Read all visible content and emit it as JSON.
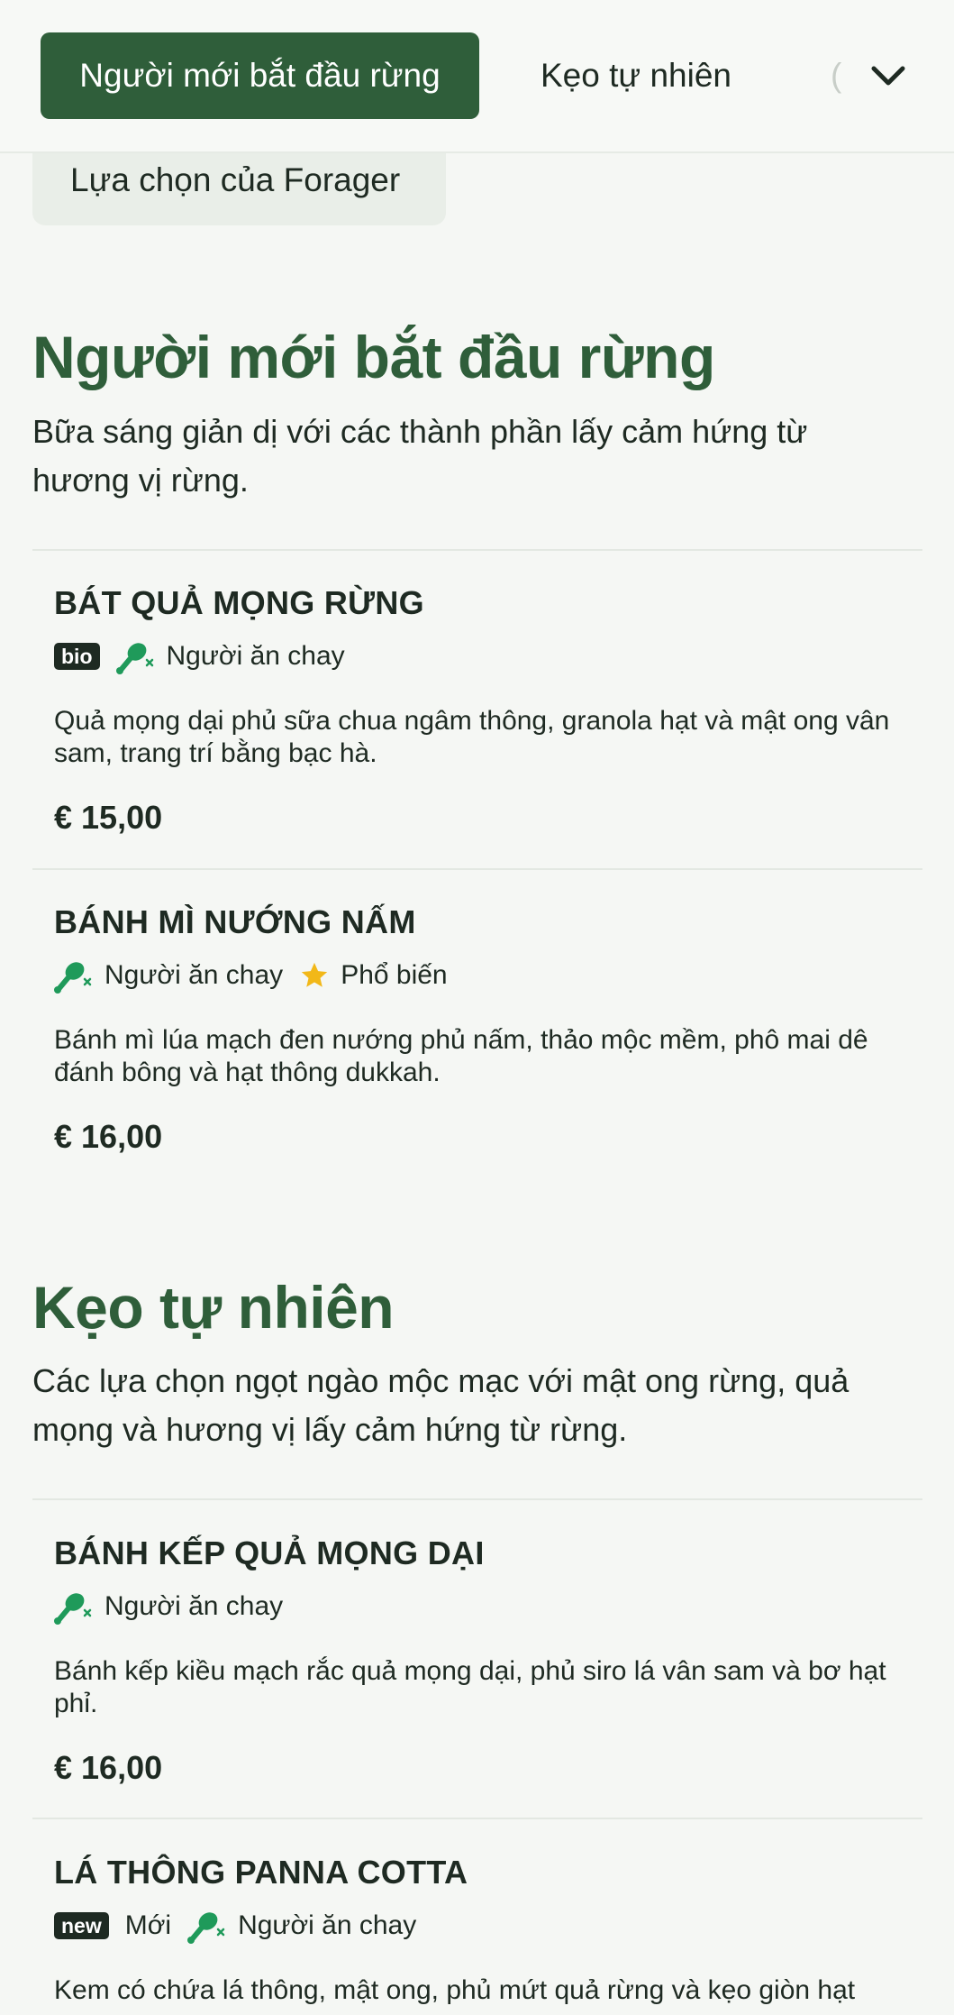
{
  "nav": {
    "active_tab": "Người mới bắt đầu rừng",
    "tab_2": "Kẹo tự nhiên",
    "partial_tab": "Lựa chọn của Forager"
  },
  "sections": [
    {
      "title": "Người mới bắt đầu rừng",
      "description": "Bữa sáng giản dị với các thành phần lấy cảm hứng từ hương vị rừng.",
      "items": [
        {
          "name": "BÁT QUẢ MỌNG RỪNG",
          "badge": "bio",
          "tags": [
            "Người ăn chay"
          ],
          "description": "Quả mọng dại phủ sữa chua ngâm thông, granola hạt và mật ong vân sam, trang trí bằng bạc hà.",
          "price": "€ 15,00"
        },
        {
          "name": "BÁNH MÌ NƯỚNG NẤM",
          "tags": [
            "Người ăn chay",
            "Phổ biến"
          ],
          "description": "Bánh mì lúa mạch đen nướng phủ nấm, thảo mộc mềm, phô mai dê đánh bông và hạt thông dukkah.",
          "price": "€ 16,00"
        }
      ]
    },
    {
      "title": "Kẹo tự nhiên",
      "description": "Các lựa chọn ngọt ngào mộc mạc với mật ong rừng, quả mọng và hương vị lấy cảm hứng từ rừng.",
      "items": [
        {
          "name": "BÁNH KẾP QUẢ MỌNG DẠI",
          "tags": [
            "Người ăn chay"
          ],
          "description": "Bánh kếp kiều mạch rắc quả mọng dại, phủ siro lá vân sam và bơ hạt phỉ.",
          "price": "€ 16,00"
        },
        {
          "name": "LÁ THÔNG PANNA COTTA",
          "badge": "new",
          "tags": [
            "Mới",
            "Người ăn chay"
          ],
          "description": "Kem có chứa lá thông, mật ong, phủ mứt quả rừng và kẹo giòn hạt"
        }
      ]
    }
  ],
  "colors": {
    "accent": "#2f5e3a",
    "veg_icon": "#1f9a5a",
    "star": "#f2b818",
    "background": "#f5f7f4"
  }
}
